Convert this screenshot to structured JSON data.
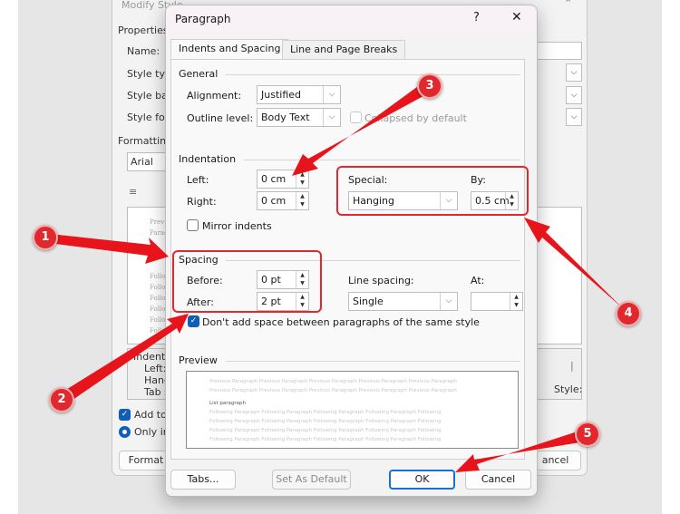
{
  "modify_style": {
    "title": "Modify Style",
    "properties": "Properties",
    "name_label": "Name:",
    "style_type_label": "Style typ",
    "style_based_label": "Style bas",
    "style_for_label": "Style for",
    "formatting": "Formatting",
    "font": "Arial",
    "desc_lines": [
      "Indent:",
      "Left:",
      "Hang",
      "Tab s"
    ],
    "style_label": "Style:",
    "add_to": "Add to",
    "only_in": "Only in",
    "format_button": "Format",
    "cancel_button": "ancel",
    "preview_lines": [
      "Prev",
      "Parag",
      "Follo",
      "Follo",
      "Follo",
      "Follo",
      "Follo",
      "Follo",
      "Follo"
    ]
  },
  "dialog": {
    "title": "Paragraph",
    "help": "?",
    "close": "✕",
    "tabs": [
      {
        "label": "Indents and Spacing",
        "active": true
      },
      {
        "label": "Line and Page Breaks",
        "active": false
      }
    ],
    "general": {
      "heading": "General",
      "alignment_label": "Alignment:",
      "alignment_value": "Justified",
      "outline_label": "Outline level:",
      "outline_value": "Body Text",
      "collapsed_label": "Collapsed by default",
      "collapsed_checked": false
    },
    "indentation": {
      "heading": "Indentation",
      "left_label": "Left:",
      "left_value": "0 cm",
      "right_label": "Right:",
      "right_value": "0 cm",
      "special_label": "Special:",
      "special_value": "Hanging",
      "by_label": "By:",
      "by_value": "0.5 cm",
      "mirror_label": "Mirror indents",
      "mirror_checked": false
    },
    "spacing": {
      "heading": "Spacing",
      "before_label": "Before:",
      "before_value": "0 pt",
      "after_label": "After:",
      "after_value": "2 pt",
      "line_spacing_label": "Line spacing:",
      "line_spacing_value": "Single",
      "at_label": "At:",
      "at_value": "",
      "dont_add_label": "Don't add space between paragraphs of the same style",
      "dont_add_checked": true
    },
    "preview": {
      "heading": "Preview",
      "previous": "Previous Paragraph Previous Paragraph Previous Paragraph Previous Paragraph Previous Paragraph",
      "current": "List paragraph",
      "following": "Following Paragraph Following Paragraph Following Paragraph Following Paragraph Following"
    },
    "buttons": {
      "tabs": "Tabs...",
      "set_default": "Set As Default",
      "ok": "OK",
      "cancel": "Cancel"
    }
  },
  "annotations": [
    "1",
    "2",
    "3",
    "4",
    "5"
  ],
  "colors": {
    "annotation": "#e0282e",
    "accent": "#0f5fb8"
  }
}
